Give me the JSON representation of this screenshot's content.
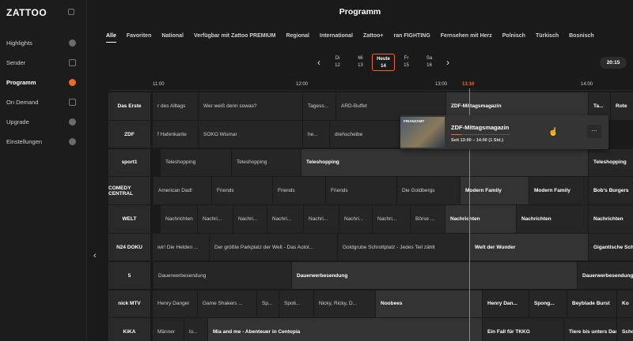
{
  "sidebar": {
    "logo": "ZATTOO",
    "items": [
      {
        "label": "Highlights"
      },
      {
        "label": "Sender"
      },
      {
        "label": "Programm"
      },
      {
        "label": "On Demand"
      },
      {
        "label": "Upgrade"
      },
      {
        "label": "Einstellungen"
      }
    ]
  },
  "header": {
    "title": "Programm"
  },
  "categories": [
    "Alle",
    "Favoriten",
    "National",
    "Verfügbar mit Zattoo PREMIUM",
    "Regional",
    "International",
    "Zattoo+",
    "ran FIGHTING",
    "Fernsehen mit Herz",
    "Polnisch",
    "Türkisch",
    "Bosnisch"
  ],
  "days": [
    {
      "d": "Di",
      "n": "12"
    },
    {
      "d": "Mi",
      "n": "13"
    },
    {
      "d": "Heute",
      "n": "14"
    },
    {
      "d": "Fr",
      "n": "15"
    },
    {
      "d": "Sa",
      "n": "16"
    }
  ],
  "time_button": "20:15",
  "ruler": {
    "t1": "11:00",
    "t2": "12:00",
    "t3": "13:00",
    "now": "13:10",
    "t4": "14:00"
  },
  "channels": [
    {
      "logo": "Das Erste",
      "programs": [
        "r des Alltags",
        "Wer weiß denn sowas?",
        "Tagess...",
        "ARD-Buffet",
        "ZDF-Mittagsmagazin",
        "Ta...",
        "Rote"
      ]
    },
    {
      "logo": "ZDF",
      "programs": [
        "f Hafenkante",
        "SOKO Wismar",
        "he...",
        "drehscheibe"
      ]
    },
    {
      "logo": "sport1",
      "programs": [
        "Teleshopping",
        "Teleshopping",
        "Teleshopping",
        "Teleshopping"
      ]
    },
    {
      "logo": "COMEDY CENTRAL",
      "programs": [
        "American Dad!",
        "Friends",
        "Friends",
        "Friends",
        "Die Goldbergs",
        "Modern Family",
        "Modern Family",
        "Bob's Burgers"
      ]
    },
    {
      "logo": "WELT",
      "programs": [
        "Nachrichten",
        "Nachri...",
        "Nachri...",
        "Nachri...",
        "Nachri...",
        "Nachri...",
        "Nachri...",
        "Börse ...",
        "Nachrichten",
        "Nachrichten",
        "Nachrichten"
      ]
    },
    {
      "logo": "N24 DOKU",
      "programs": [
        "wir! Die Helden ...",
        "Der größte Parkplatz der Welt - Das Autot...",
        "Goldgrube Schrottplatz - Jedes Teil zählt",
        "Welt der Wunder",
        "Gigantische Sch"
      ]
    },
    {
      "logo": "5",
      "programs": [
        "Dauerwerbesendung",
        "Dauerwerbesendung",
        "Dauerwerbesendung"
      ]
    },
    {
      "logo": "nick MTV",
      "programs": [
        "Henry Danger",
        "Game Shakers ...",
        "Sp...",
        "Spoti...",
        "Nicky, Ricky, D...",
        "Noobees",
        "Henry Dan...",
        "Spong...",
        "Beyblade Burst",
        "Ko"
      ]
    },
    {
      "logo": "KiKA",
      "programs": [
        "Männer",
        "lo...",
        "Mia and me - Abenteuer in Centopia",
        "Ein Fall für TKKG",
        "Tiere bis unters Dach",
        "Scho"
      ]
    }
  ],
  "popup": {
    "title": "ZDF-Mittagsmagazin",
    "time": "Seit 13:00 – 14:00 (1 Std.)",
    "thumb_label": "FINANZAMT",
    "more": "...",
    "progress": 0.17
  },
  "colors": {
    "accent": "#f06a26",
    "bg": "#1a1a1a"
  }
}
